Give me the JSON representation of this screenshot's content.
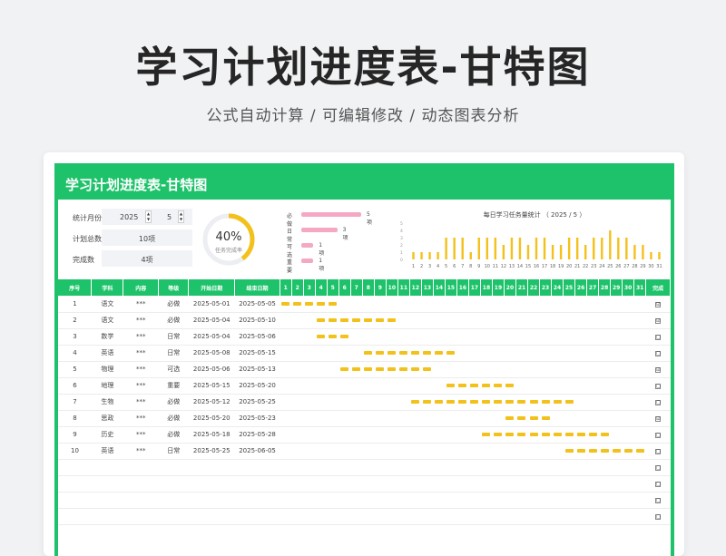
{
  "hero": {
    "title": "学习计划进度表-甘特图",
    "subtitle": "公式自动计算 /  可编辑修改  / 动态图表分析"
  },
  "sheet": {
    "title": "学习计划进度表-甘特图"
  },
  "info": {
    "month_label": "统计月份",
    "year": "2025",
    "month": "5",
    "total_label": "计划总数",
    "total_value": "10项",
    "done_label": "完成数",
    "done_value": "4项"
  },
  "donut": {
    "percent_text": "40%",
    "percent": 0.4,
    "label": "任务完成率"
  },
  "levels": [
    {
      "name": "必做",
      "count": 5,
      "count_text": "5项"
    },
    {
      "name": "日常",
      "count": 3,
      "count_text": "3项"
    },
    {
      "name": "可选",
      "count": 1,
      "count_text": "1项"
    },
    {
      "name": "重要",
      "count": 1,
      "count_text": "1项"
    }
  ],
  "chart_data": {
    "type": "bar",
    "title": "每日学习任务量统计    （ 2025 / 5 ）",
    "categories": [
      "1",
      "2",
      "3",
      "4",
      "5",
      "6",
      "7",
      "8",
      "9",
      "10",
      "11",
      "12",
      "13",
      "14",
      "15",
      "16",
      "17",
      "18",
      "19",
      "20",
      "21",
      "22",
      "23",
      "24",
      "25",
      "26",
      "27",
      "28",
      "29",
      "30",
      "31"
    ],
    "values": [
      1,
      1,
      1,
      1,
      3,
      3,
      3,
      1,
      3,
      3,
      3,
      2,
      3,
      3,
      2,
      3,
      3,
      2,
      2,
      3,
      3,
      2,
      3,
      3,
      4,
      3,
      3,
      2,
      2,
      1,
      1
    ],
    "ylim": [
      0,
      5
    ],
    "yticks": [
      "0",
      "1",
      "2",
      "3",
      "4",
      "5"
    ],
    "color": "#f3c11b"
  },
  "columns": {
    "no": "序号",
    "subject": "学科",
    "content": "内容",
    "level": "等级",
    "start": "开始日期",
    "end": "结束日期",
    "done": "完成"
  },
  "days": [
    "1",
    "2",
    "3",
    "4",
    "5",
    "6",
    "7",
    "8",
    "9",
    "10",
    "11",
    "12",
    "13",
    "14",
    "15",
    "16",
    "17",
    "18",
    "19",
    "20",
    "21",
    "22",
    "23",
    "24",
    "25",
    "26",
    "27",
    "28",
    "29",
    "30",
    "31"
  ],
  "rows": [
    {
      "no": "1",
      "subject": "语文",
      "content": "***",
      "level": "必做",
      "start": "2025-05-01",
      "end": "2025-05-05",
      "s": 1,
      "e": 5,
      "done": "☑"
    },
    {
      "no": "2",
      "subject": "语文",
      "content": "***",
      "level": "必做",
      "start": "2025-05-04",
      "end": "2025-05-10",
      "s": 4,
      "e": 10,
      "done": "☑"
    },
    {
      "no": "3",
      "subject": "数学",
      "content": "***",
      "level": "日常",
      "start": "2025-05-04",
      "end": "2025-05-06",
      "s": 4,
      "e": 6,
      "done": "□"
    },
    {
      "no": "4",
      "subject": "英语",
      "content": "***",
      "level": "日常",
      "start": "2025-05-08",
      "end": "2025-05-15",
      "s": 8,
      "e": 15,
      "done": "□"
    },
    {
      "no": "5",
      "subject": "物理",
      "content": "***",
      "level": "可选",
      "start": "2025-05-06",
      "end": "2025-05-13",
      "s": 6,
      "e": 13,
      "done": "☑"
    },
    {
      "no": "6",
      "subject": "地理",
      "content": "***",
      "level": "重要",
      "start": "2025-05-15",
      "end": "2025-05-20",
      "s": 15,
      "e": 20,
      "done": "□"
    },
    {
      "no": "7",
      "subject": "生物",
      "content": "***",
      "level": "必做",
      "start": "2025-05-12",
      "end": "2025-05-25",
      "s": 12,
      "e": 25,
      "done": "□"
    },
    {
      "no": "8",
      "subject": "思政",
      "content": "***",
      "level": "必做",
      "start": "2025-05-20",
      "end": "2025-05-23",
      "s": 20,
      "e": 23,
      "done": "☑"
    },
    {
      "no": "9",
      "subject": "历史",
      "content": "***",
      "level": "必做",
      "start": "2025-05-18",
      "end": "2025-05-28",
      "s": 18,
      "e": 28,
      "done": "□"
    },
    {
      "no": "10",
      "subject": "英语",
      "content": "***",
      "level": "日常",
      "start": "2025-05-25",
      "end": "2025-06-05",
      "s": 25,
      "e": 31,
      "done": "□"
    },
    {
      "no": "",
      "subject": "",
      "content": "",
      "level": "",
      "start": "",
      "end": "",
      "s": 0,
      "e": 0,
      "done": "□"
    },
    {
      "no": "",
      "subject": "",
      "content": "",
      "level": "",
      "start": "",
      "end": "",
      "s": 0,
      "e": 0,
      "done": "□"
    },
    {
      "no": "",
      "subject": "",
      "content": "",
      "level": "",
      "start": "",
      "end": "",
      "s": 0,
      "e": 0,
      "done": "□"
    },
    {
      "no": "",
      "subject": "",
      "content": "",
      "level": "",
      "start": "",
      "end": "",
      "s": 0,
      "e": 0,
      "done": "□"
    }
  ]
}
